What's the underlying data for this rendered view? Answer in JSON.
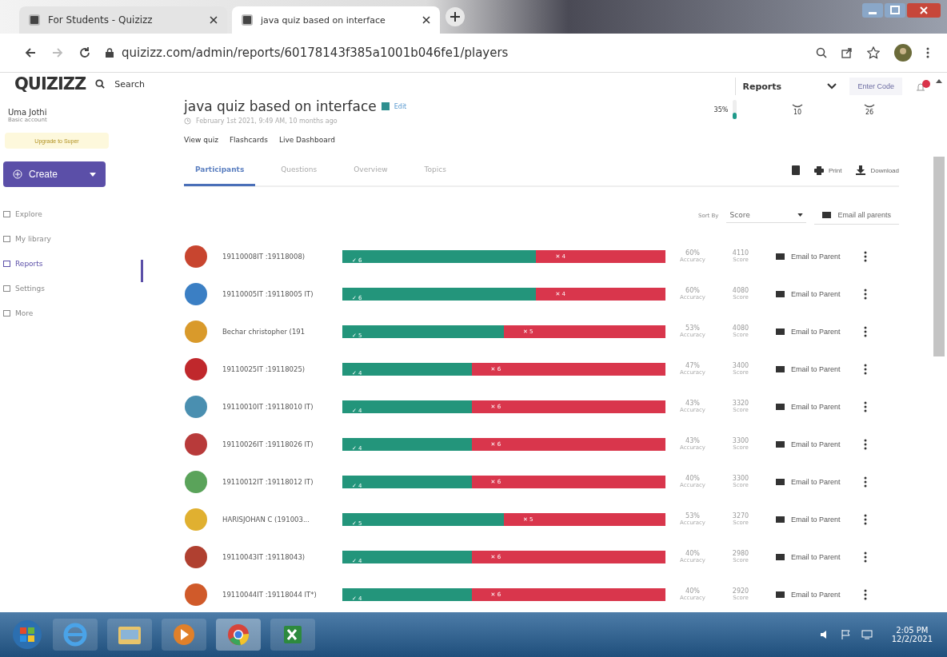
{
  "browser": {
    "tabs": [
      {
        "title": "For Students - Quizizz",
        "selected": false
      },
      {
        "title": "java quiz based on interface",
        "selected": true
      }
    ],
    "url": "quizizz.com/admin/reports/60178143f385a1001b046fe1/players"
  },
  "topbar": {
    "logo": "QUIZIZZ",
    "search": "Search",
    "menu": "Reports",
    "enter_code": "Enter Code"
  },
  "sidebar": {
    "user_name": "Uma Jothi",
    "account": "Basic account",
    "upgrade": "Upgrade to Super",
    "create": "Create",
    "items": [
      {
        "label": "Explore",
        "selected": false
      },
      {
        "label": "My library",
        "selected": false
      },
      {
        "label": "Reports",
        "selected": true
      },
      {
        "label": "Settings",
        "selected": false
      },
      {
        "label": "More",
        "selected": false
      }
    ]
  },
  "quiz": {
    "title": "java quiz based on interface",
    "edit": "Edit",
    "date": "February 1st 2021, 9:49 AM, 10 months ago",
    "links": [
      "View quiz",
      "Flashcards",
      "Live Dashboard"
    ],
    "stats": [
      {
        "kind": "gauge",
        "value": "35%",
        "level": 0.35
      },
      {
        "kind": "icon",
        "value": "10"
      },
      {
        "kind": "icon",
        "value": "26"
      }
    ]
  },
  "tabs": [
    {
      "label": "Participants",
      "selected": true
    },
    {
      "label": "Questions",
      "selected": false
    },
    {
      "label": "Overview",
      "selected": false
    },
    {
      "label": "Topics",
      "selected": false
    }
  ],
  "actions": {
    "print": "Print",
    "download": "Download"
  },
  "sort": {
    "label": "Sort By",
    "value": "Score",
    "email_all": "Email all parents"
  },
  "rows": [
    {
      "color": "#c8452f",
      "name": "19110008IT :19118008)",
      "level": 0.6,
      "correct": "✓ 6",
      "incorrect": "✕ 4",
      "accuracy": "60%",
      "accuracy_label": "Accuracy",
      "score": "4110",
      "score_label": "Score",
      "email": "Email to Parent"
    },
    {
      "color": "#3b7fc4",
      "name": "19110005IT :19118005 IT)",
      "level": 0.6,
      "correct": "✓ 6",
      "incorrect": "✕ 4",
      "accuracy": "60%",
      "accuracy_label": "Accuracy",
      "score": "4080",
      "score_label": "Score",
      "email": "Email to Parent"
    },
    {
      "color": "#d99a2b",
      "name": "Bechar christopher (191",
      "level": 0.5,
      "correct": "✓ 5",
      "incorrect": "✕ 5",
      "accuracy": "53%",
      "accuracy_label": "Accuracy",
      "score": "4080",
      "score_label": "Score",
      "email": "Email to Parent"
    },
    {
      "color": "#c0282c",
      "name": "19110025IT :19118025)",
      "level": 0.4,
      "correct": "✓ 4",
      "incorrect": "✕ 6",
      "accuracy": "47%",
      "accuracy_label": "Accuracy",
      "score": "3400",
      "score_label": "Score",
      "email": "Email to Parent"
    },
    {
      "color": "#4a8fb0",
      "name": "19110010IT :19118010 IT)",
      "level": 0.4,
      "correct": "✓ 4",
      "incorrect": "✕ 6",
      "accuracy": "43%",
      "accuracy_label": "Accuracy",
      "score": "3320",
      "score_label": "Score",
      "email": "Email to Parent"
    },
    {
      "color": "#b83a3a",
      "name": "19110026IT :19118026 IT)",
      "level": 0.4,
      "correct": "✓ 4",
      "incorrect": "✕ 6",
      "accuracy": "43%",
      "accuracy_label": "Accuracy",
      "score": "3300",
      "score_label": "Score",
      "email": "Email to Parent"
    },
    {
      "color": "#5aa35a",
      "name": "19110012IT :19118012 IT)",
      "level": 0.4,
      "correct": "✓ 4",
      "incorrect": "✕ 6",
      "accuracy": "40%",
      "accuracy_label": "Accuracy",
      "score": "3300",
      "score_label": "Score",
      "email": "Email to Parent"
    },
    {
      "color": "#e0b030",
      "name": "HARISJOHAN C (191003...",
      "level": 0.5,
      "correct": "✓ 5",
      "incorrect": "✕ 5",
      "accuracy": "53%",
      "accuracy_label": "Accuracy",
      "score": "3270",
      "score_label": "Score",
      "email": "Email to Parent"
    },
    {
      "color": "#b04030",
      "name": "19110043IT :19118043)",
      "level": 0.4,
      "correct": "✓ 4",
      "incorrect": "✕ 6",
      "accuracy": "40%",
      "accuracy_label": "Accuracy",
      "score": "2980",
      "score_label": "Score",
      "email": "Email to Parent"
    },
    {
      "color": "#d05a2a",
      "name": "19110044IT :19118044 IT*)",
      "level": 0.4,
      "correct": "✓ 4",
      "incorrect": "✕ 6",
      "accuracy": "40%",
      "accuracy_label": "Accuracy",
      "score": "2920",
      "score_label": "Score",
      "email": "Email to Parent"
    }
  ],
  "taskbar": {
    "apps": [
      {
        "kind": "ie"
      },
      {
        "kind": "folder"
      },
      {
        "kind": "media"
      },
      {
        "kind": "chrome"
      },
      {
        "kind": "excel"
      }
    ],
    "time": "2:05 PM",
    "date": "12/2/2021"
  }
}
